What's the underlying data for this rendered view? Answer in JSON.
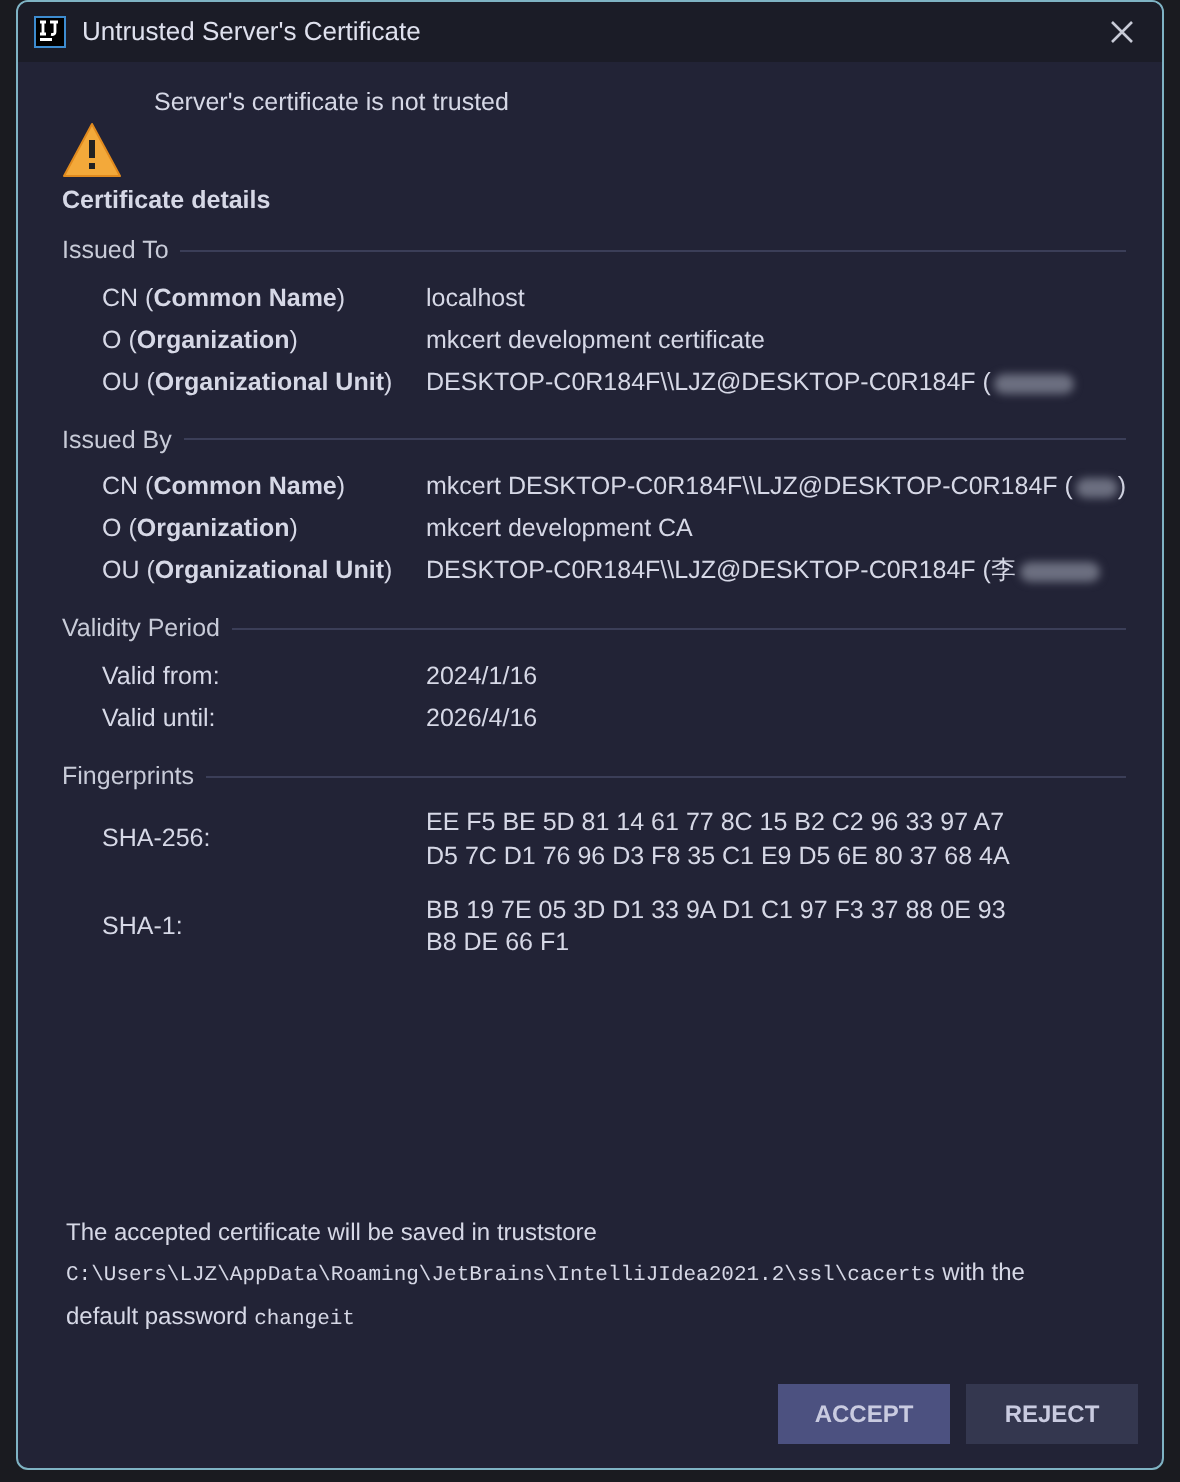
{
  "window": {
    "title": "Untrusted Server's Certificate"
  },
  "message": "Server's certificate is not trusted",
  "details_heading": "Certificate details",
  "sections": [
    {
      "title": "Issued To",
      "rows": [
        {
          "label": "CN (**Common Name**)",
          "value": "localhost",
          "redacted": false
        },
        {
          "label": "O (**Organization**)",
          "value": "mkcert development certificate",
          "redacted": false
        },
        {
          "label": "OU (**Organizational Unit**)",
          "value": "DESKTOP-C0R184F\\\\LJZ@DESKTOP-C0R184F (",
          "redacted": true
        }
      ]
    },
    {
      "title": "Issued By",
      "rows": [
        {
          "label": "CN (**Common Name**)",
          "value": "mkcert DESKTOP-C0R184F\\\\LJZ@DESKTOP-C0R184F (",
          "redacted": true,
          "suffix": ")"
        },
        {
          "label": "O (**Organization**)",
          "value": "mkcert development CA",
          "redacted": false
        },
        {
          "label": "OU (**Organizational Unit**)",
          "value": "DESKTOP-C0R184F\\\\LJZ@DESKTOP-C0R184F (李",
          "redacted": true
        }
      ]
    },
    {
      "title": "Validity Period",
      "rows": [
        {
          "label": "Valid from:",
          "value": "2024/1/16",
          "redacted": false
        },
        {
          "label": "Valid until:",
          "value": "2026/4/16",
          "redacted": false
        }
      ]
    },
    {
      "title": "Fingerprints",
      "rows": [
        {
          "label": "SHA-256:",
          "value": "EE F5 BE 5D 81 14 61 77 8C 15 B2 C2 96 33 97 A7 D5 7C D1 76 96 D3 F8 35 C1 E9 D5 6E 80 37 68 4A",
          "redacted": false
        },
        {
          "label": "SHA-1:",
          "value": "BB 19 7E 05 3D D1 33 9A D1 C1 97 F3 37 88 0E 93 B8 DE 66 F1",
          "redacted": false
        }
      ]
    }
  ],
  "note": [
    {
      "kind": "text",
      "text": "The accepted certificate will be saved in truststore "
    },
    {
      "kind": "code",
      "text": "C:\\Users\\LJZ\\AppData\\Roaming\\JetBrains\\IntelliJIdea2021.2\\ssl\\cacerts"
    },
    {
      "kind": "text",
      "text": " with the default password "
    },
    {
      "kind": "code",
      "text": "changeit"
    }
  ],
  "buttons": [
    {
      "label": "ACCEPT",
      "kind": "primary"
    },
    {
      "label": "REJECT",
      "kind": "secondary"
    }
  ]
}
